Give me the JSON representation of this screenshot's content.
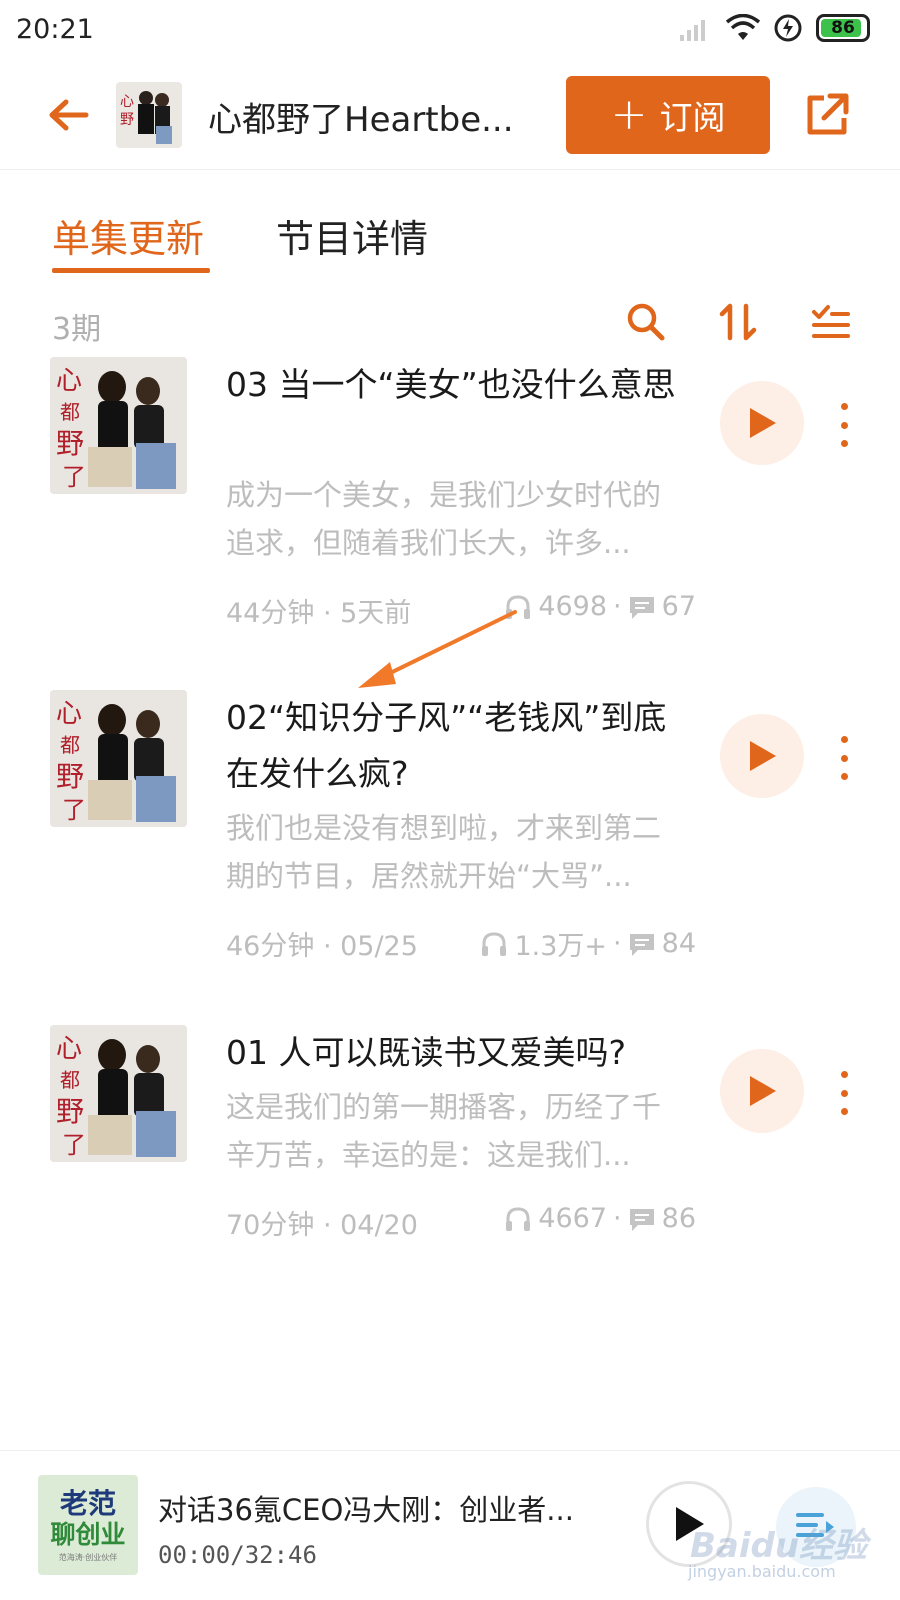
{
  "status_bar": {
    "time": "20:21",
    "battery": "86"
  },
  "header": {
    "title": "心都野了Heartbe...",
    "subscribe_label": "订阅",
    "subscribe_plus": "+"
  },
  "tabs": [
    {
      "label": "单集更新",
      "active": true
    },
    {
      "label": "节目详情",
      "active": false
    }
  ],
  "toolbar": {
    "episode_count": "3期"
  },
  "episodes": [
    {
      "title": "03 当一个“美女”也没什么意思",
      "description": "成为一个美女，是我们少女时代的追求，但随着我们长大，许多...",
      "duration_date": "44分钟 · 5天前",
      "plays": "4698",
      "comments": "67"
    },
    {
      "title": "02“知识分子风”“老钱风”到底在发什么疯?",
      "description": "我们也是没有想到啦，才来到第二期的节目，居然就开始“大骂”...",
      "duration_date": "46分钟 · 05/25",
      "plays": "1.3万+",
      "comments": "84"
    },
    {
      "title": "01 人可以既读书又爱美吗?",
      "description": "这是我们的第一期播客，历经了千辛万苦，幸运的是：这是我们...",
      "duration_date": "70分钟 · 04/20",
      "plays": "4667",
      "comments": "86"
    }
  ],
  "cover_art": {
    "text_line1": "心",
    "text_line2": "都",
    "text_line3": "野",
    "text_line4": "了"
  },
  "player": {
    "cover_line1": "老范",
    "cover_line2": "聊创业",
    "cover_line3": "范海涛·创业伙伴",
    "title": "对话36氪CEO冯大刚：创业者...",
    "time": "00:00/32:46"
  },
  "watermark": {
    "main": "Baidu经验",
    "sub": "jingyan.baidu.com"
  },
  "colors": {
    "accent": "#e0661c",
    "muted": "#bdbdbd",
    "play_bg": "#fdeee6"
  }
}
